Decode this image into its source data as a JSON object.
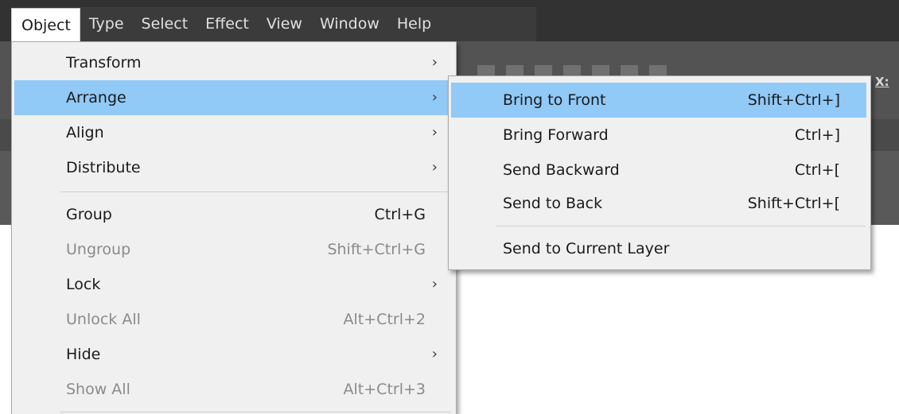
{
  "menubar": {
    "items": [
      {
        "label": "Object"
      },
      {
        "label": "Type"
      },
      {
        "label": "Select"
      },
      {
        "label": "Effect"
      },
      {
        "label": "View"
      },
      {
        "label": "Window"
      },
      {
        "label": "Help"
      }
    ]
  },
  "control_bar": {
    "x_label": "X:"
  },
  "object_menu": {
    "items": [
      {
        "label": "Transform",
        "shortcut": "",
        "submenu": true,
        "enabled": true
      },
      {
        "label": "Arrange",
        "shortcut": "",
        "submenu": true,
        "enabled": true,
        "highlighted": true
      },
      {
        "label": "Align",
        "shortcut": "",
        "submenu": true,
        "enabled": true
      },
      {
        "label": "Distribute",
        "shortcut": "",
        "submenu": true,
        "enabled": true
      },
      {
        "label": "Group",
        "shortcut": "Ctrl+G",
        "submenu": false,
        "enabled": true
      },
      {
        "label": "Ungroup",
        "shortcut": "Shift+Ctrl+G",
        "submenu": false,
        "enabled": false
      },
      {
        "label": "Lock",
        "shortcut": "",
        "submenu": true,
        "enabled": true
      },
      {
        "label": "Unlock All",
        "shortcut": "Alt+Ctrl+2",
        "submenu": false,
        "enabled": false
      },
      {
        "label": "Hide",
        "shortcut": "",
        "submenu": true,
        "enabled": true
      },
      {
        "label": "Show All",
        "shortcut": "Alt+Ctrl+3",
        "submenu": false,
        "enabled": false
      }
    ]
  },
  "arrange_submenu": {
    "items": [
      {
        "label": "Bring to Front",
        "shortcut": "Shift+Ctrl+]",
        "highlighted": true
      },
      {
        "label": "Bring Forward",
        "shortcut": "Ctrl+]"
      },
      {
        "label": "Send Backward",
        "shortcut": "Ctrl+["
      },
      {
        "label": "Send to Back",
        "shortcut": "Shift+Ctrl+["
      },
      {
        "label": "Send to Current Layer",
        "shortcut": ""
      }
    ]
  },
  "icons": {
    "submenu_arrow": "chevron-right-icon"
  },
  "colors": {
    "menu_background": "#f0f0f0",
    "highlight": "#91c9f7",
    "disabled_text": "#8a8a8a",
    "menubar_background": "#323232",
    "app_background": "#535353"
  }
}
